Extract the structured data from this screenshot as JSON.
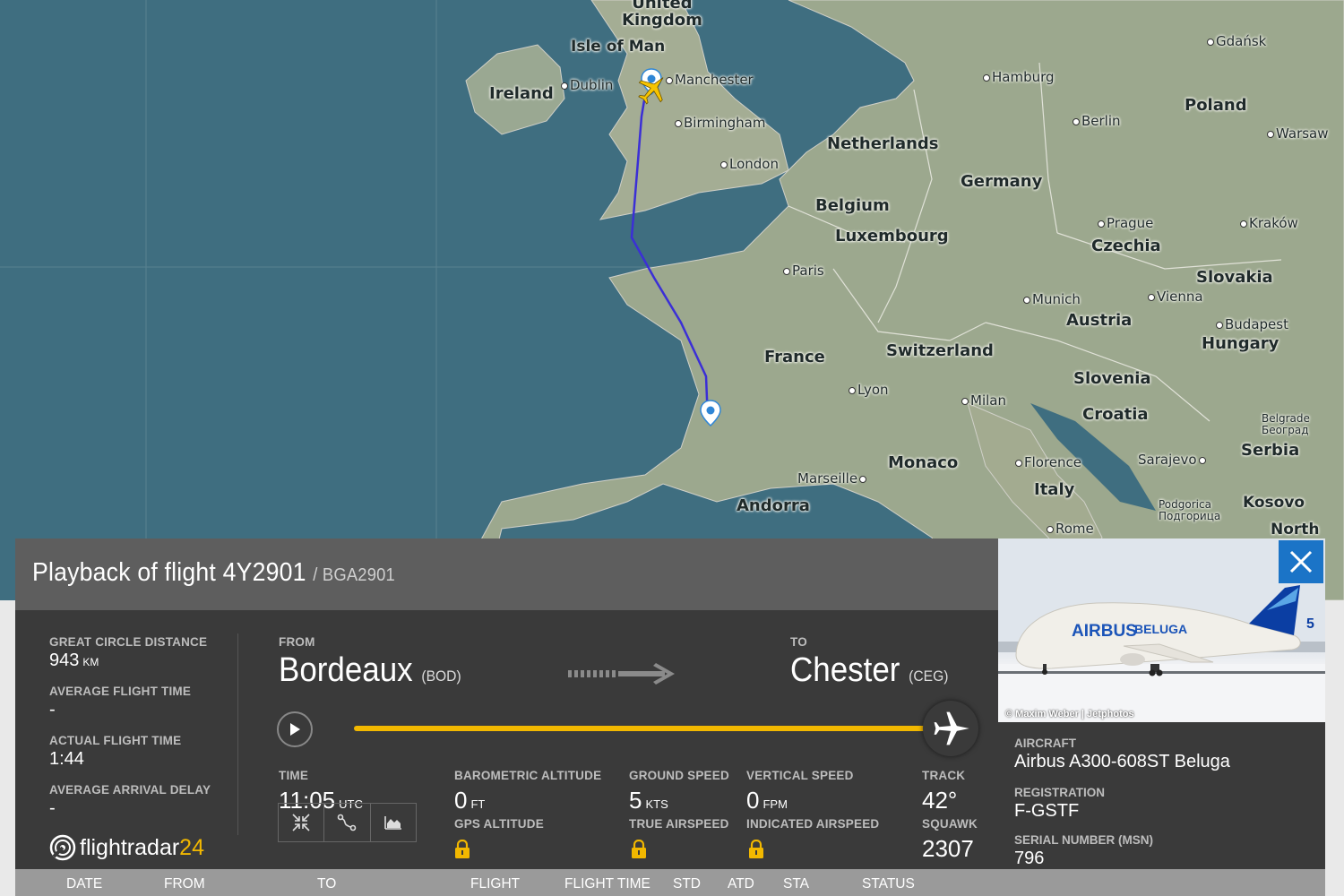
{
  "map": {
    "countries": [
      {
        "name": "United\nKingdom",
        "key": "uk"
      },
      {
        "name": "Isle of Man",
        "key": "iom"
      },
      {
        "name": "Ireland",
        "key": "ireland"
      },
      {
        "name": "Netherlands",
        "key": "nl"
      },
      {
        "name": "Germany",
        "key": "de"
      },
      {
        "name": "Belgium",
        "key": "be"
      },
      {
        "name": "Luxembourg",
        "key": "lu"
      },
      {
        "name": "Poland",
        "key": "pl"
      },
      {
        "name": "Czechia",
        "key": "cz"
      },
      {
        "name": "Slovakia",
        "key": "sk"
      },
      {
        "name": "Austria",
        "key": "at"
      },
      {
        "name": "Hungary",
        "key": "hu"
      },
      {
        "name": "France",
        "key": "fr"
      },
      {
        "name": "Switzerland",
        "key": "ch"
      },
      {
        "name": "Slovenia",
        "key": "si"
      },
      {
        "name": "Croatia",
        "key": "hr"
      },
      {
        "name": "Serbia",
        "key": "rs"
      },
      {
        "name": "Monaco",
        "key": "mc"
      },
      {
        "name": "Italy",
        "key": "it"
      },
      {
        "name": "Andorra",
        "key": "ad"
      },
      {
        "name": "Kosovo",
        "key": "xk"
      },
      {
        "name": "North",
        "key": "mk"
      }
    ],
    "cities": {
      "dublin": "Dublin",
      "manchester": "Manchester",
      "birmingham": "Birmingham",
      "london": "London",
      "hamburg": "Hamburg",
      "gdansk": "Gdańsk",
      "berlin": "Berlin",
      "warsaw": "Warsaw",
      "prague": "Prague",
      "krakow": "Kraków",
      "paris": "Paris",
      "munich": "Munich",
      "vienna": "Vienna",
      "budapest": "Budapest",
      "lyon": "Lyon",
      "milan": "Milan",
      "marseille": "Marseille",
      "florence": "Florence",
      "sarajevo": "Sarajevo",
      "rome": "Rome",
      "belgrade": "Belgrade\nБеоград",
      "podgorica": "Podgorica\nПодгорица"
    }
  },
  "panel": {
    "title": "Playback of flight 4Y2901",
    "callsign": "/ BGA2901",
    "great_circle_label": "GREAT CIRCLE DISTANCE",
    "great_circle_value": "943",
    "great_circle_unit": "KM",
    "avg_flight_time_label": "AVERAGE FLIGHT TIME",
    "avg_flight_time_value": "-",
    "actual_flight_time_label": "ACTUAL FLIGHT TIME",
    "actual_flight_time_value": "1:44",
    "avg_arrival_delay_label": "AVERAGE ARRIVAL DELAY",
    "avg_arrival_delay_value": "-",
    "from_label": "FROM",
    "from_city": "Bordeaux",
    "from_code": "(BOD)",
    "to_label": "TO",
    "to_city": "Chester",
    "to_code": "(CEG)",
    "playback_progress": 1.0,
    "time_label": "TIME",
    "time_value": "11:05",
    "time_unit": "UTC",
    "baro_alt_label": "BAROMETRIC ALTITUDE",
    "baro_alt_value": "0",
    "baro_alt_unit": "FT",
    "gps_alt_label": "GPS ALTITUDE",
    "ground_speed_label": "GROUND SPEED",
    "ground_speed_value": "5",
    "ground_speed_unit": "KTS",
    "true_airspeed_label": "TRUE AIRSPEED",
    "vertical_speed_label": "VERTICAL SPEED",
    "vertical_speed_value": "0",
    "vertical_speed_unit": "FPM",
    "indicated_airspeed_label": "INDICATED AIRSPEED",
    "track_label": "TRACK",
    "track_value": "42°",
    "squawk_label": "SQUAWK",
    "squawk_value": "2307",
    "logo_text_a": "flightradar",
    "logo_text_b": "24"
  },
  "aircraft": {
    "photo_brand_a": "AIRBUS",
    "photo_brand_b": "BELUGA",
    "photo_tail_number": "5",
    "photo_credit": "© Maxim Weber | Jetphotos",
    "aircraft_label": "AIRCRAFT",
    "aircraft_value": "Airbus A300-608ST Beluga",
    "registration_label": "REGISTRATION",
    "registration_value": "F-GSTF",
    "serial_label": "SERIAL NUMBER (MSN)",
    "serial_value": "796"
  },
  "table": {
    "headers": [
      "DATE",
      "FROM",
      "TO",
      "FLIGHT",
      "FLIGHT TIME",
      "STD",
      "ATD",
      "STA",
      "STATUS"
    ]
  },
  "colors": {
    "accent": "#f2b800",
    "track": "#3b2fd6",
    "close": "#1b74c7",
    "panel": "#3a3a3a"
  }
}
